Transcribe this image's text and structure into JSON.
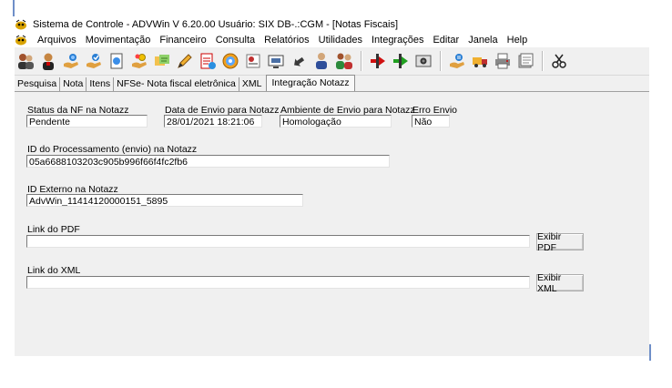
{
  "window": {
    "title": "Sistema de Controle - ADVWin  V 6.20.00 Usuário: SIX  DB-.:CGM - [Notas Fiscais]"
  },
  "menu": {
    "items": [
      "Arquivos",
      "Movimentação",
      "Financeiro",
      "Consulta",
      "Relatórios",
      "Utilidades",
      "Integrações",
      "Editar",
      "Janela",
      "Help"
    ]
  },
  "toolbar": {
    "icons": [
      "users-icon",
      "user-icon",
      "hand-icon",
      "hand-check-icon",
      "document-icon",
      "hand-coins-icon",
      "notes-icon",
      "pencil-icon",
      "checklist-icon",
      "cd-icon",
      "report-icon",
      "monitor-icon",
      "back-arrow-icon",
      "person-icon",
      "people-icon",
      "red-arrow-icon",
      "green-arrow-icon",
      "camera-icon",
      "hand-list-icon",
      "truck-icon",
      "printer-icon",
      "document-stack-icon",
      "scissors-icon"
    ]
  },
  "tabs": [
    "Pesquisa",
    "Nota",
    "Itens",
    "NFSe- Nota fiscal eletrônica",
    "XML",
    "Integração Notazz"
  ],
  "active_tab": "Integração Notazz",
  "form": {
    "status_label": "Status da NF na Notazz",
    "status_value": "Pendente",
    "data_envio_label": "Data de Envio para Notazz",
    "data_envio_value": "28/01/2021 18:21:06",
    "ambiente_label": "Ambiente de Envio para Notazz",
    "ambiente_value": "Homologação",
    "erro_label": "Erro Envio",
    "erro_value": "Não",
    "id_proc_label": "ID do Processamento (envio) na Notazz",
    "id_proc_value": "05a6688103203c905b996f66f4fc2fb6",
    "id_ext_label": "ID Externo na Notazz",
    "id_ext_value": "AdvWin_11414120000151_5895",
    "link_pdf_label": "Link do PDF",
    "link_pdf_value": "",
    "exibir_pdf": "Exibir PDF",
    "link_xml_label": "Link do XML",
    "link_xml_value": "",
    "exibir_xml": "Exibir XML"
  }
}
